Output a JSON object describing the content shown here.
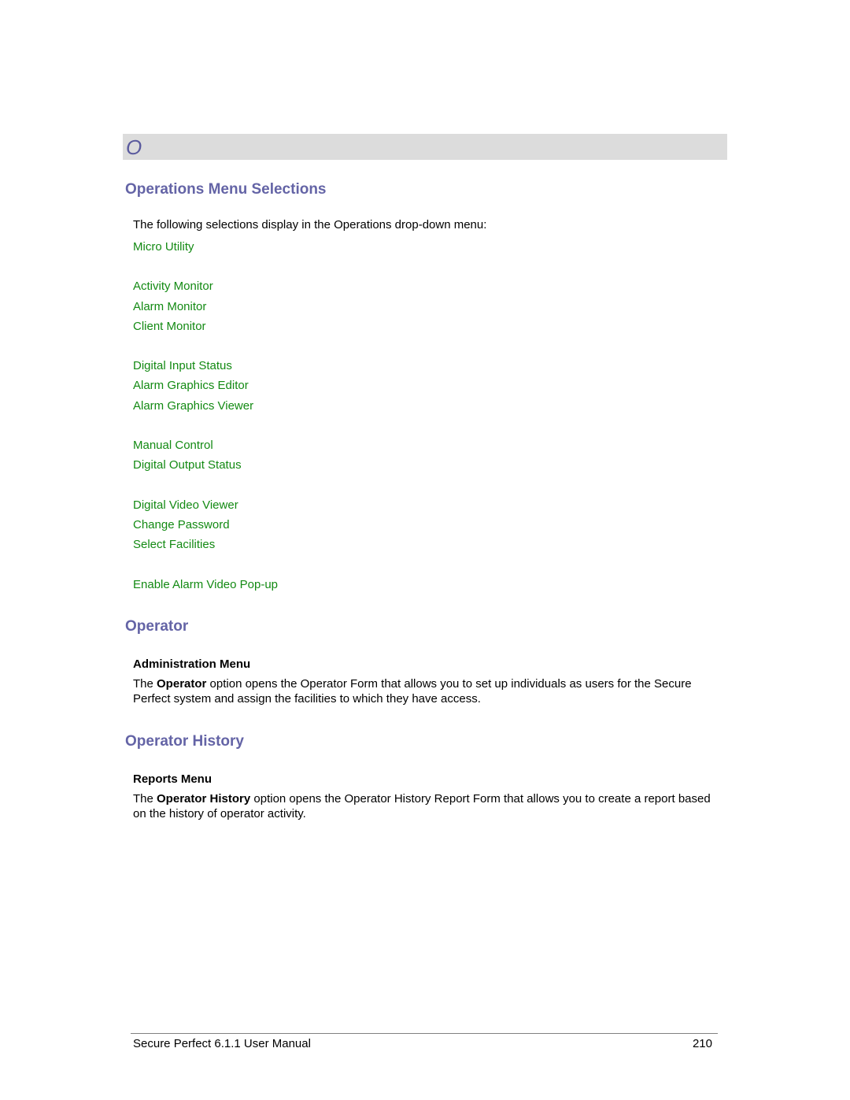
{
  "letter_bar": {
    "letter": "O"
  },
  "sections": {
    "operations_menu": {
      "title": "Operations Menu Selections",
      "intro": "The following selections display in the Operations drop-down menu:",
      "groups": [
        [
          "Micro Utility"
        ],
        [
          "Activity Monitor",
          "Alarm Monitor",
          "Client Monitor"
        ],
        [
          "Digital Input Status",
          "Alarm Graphics Editor",
          "Alarm Graphics Viewer"
        ],
        [
          "Manual Control",
          "Digital Output Status"
        ],
        [
          "Digital Video Viewer",
          "Change Password",
          "Select Facilities"
        ],
        [
          "Enable Alarm Video Pop-up"
        ]
      ]
    },
    "operator": {
      "title": "Operator",
      "menu_label": "Administration Menu",
      "para_prefix": "The ",
      "para_bold": "Operator",
      "para_suffix": " option opens the Operator Form that allows you to set up individuals as users for the Secure Perfect system and assign the facilities to which they have access."
    },
    "operator_history": {
      "title": "Operator History",
      "menu_label": "Reports Menu",
      "para_prefix": "The ",
      "para_bold": "Operator History",
      "para_suffix": " option opens the Operator History Report Form that allows you to create a report based on the history of operator activity."
    }
  },
  "footer": {
    "manual_title": "Secure Perfect 6.1.1 User Manual",
    "page_number": "210"
  },
  "colors": {
    "heading": "#6464a6",
    "link": "#138a13",
    "letter_bar_bg": "#dcdcdc"
  }
}
